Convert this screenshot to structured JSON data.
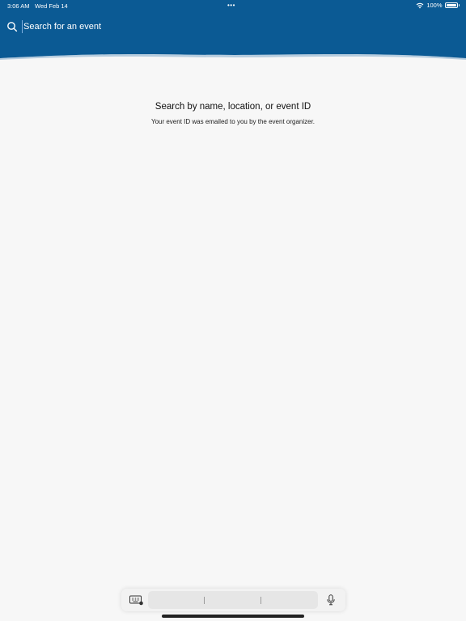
{
  "status_bar": {
    "time": "3:06 AM",
    "date": "Wed Feb 14",
    "dots": "•••",
    "battery_label": "100%",
    "battery_level": 1.0
  },
  "search": {
    "placeholder": "Search for an event",
    "icon": "search-icon"
  },
  "empty_state": {
    "title": "Search by name, location, or event ID",
    "subtitle": "Your event ID was emailed to you by the event organizer."
  },
  "keyboard_bar": {
    "toggle_icon": "keyboard-icon",
    "mic_icon": "microphone-icon"
  },
  "colors": {
    "header_bg": "#0b5a94",
    "page_bg": "#f7f7f7",
    "text_primary": "#111111"
  }
}
